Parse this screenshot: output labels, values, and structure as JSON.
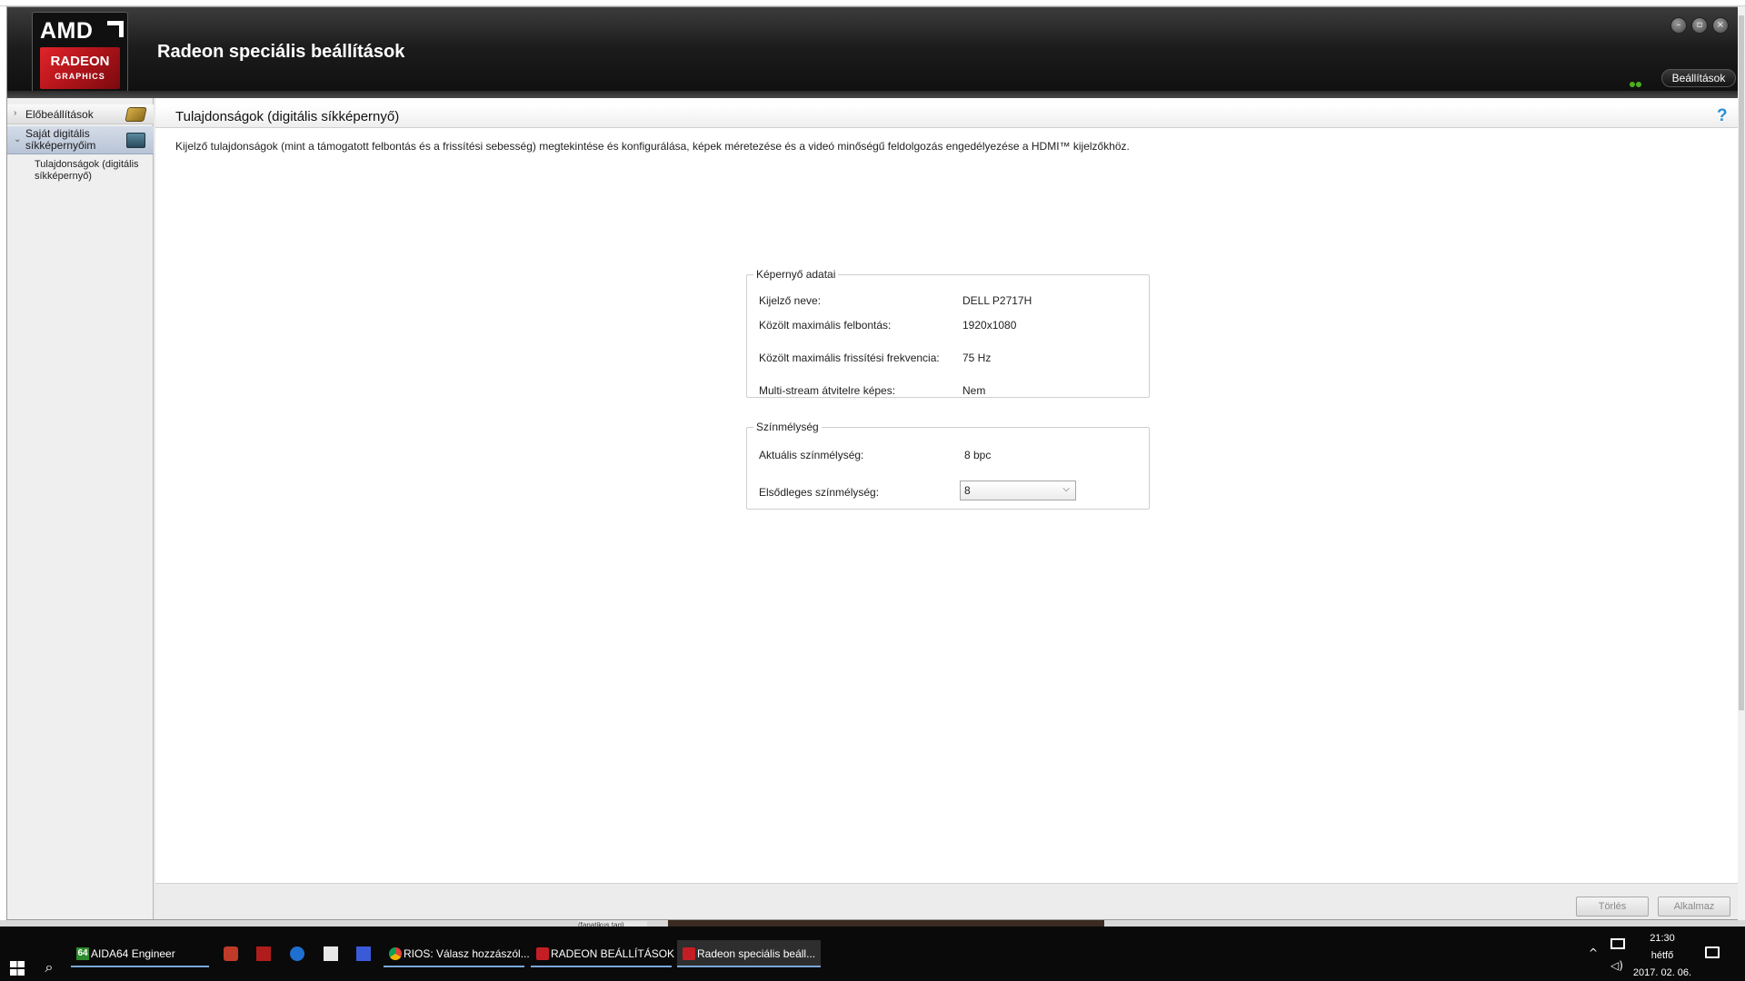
{
  "window": {
    "title": "Radeon speciális beállítások",
    "logo_brand": "AMD",
    "logo_product": "RADEON",
    "logo_sub": "GRAPHICS",
    "settings_label": "Beállítások",
    "minimize_glyph": "–",
    "restore_glyph": "▫",
    "close_glyph": "×"
  },
  "sidebar": {
    "items": [
      {
        "label": "Előbeállítások",
        "expanded": false,
        "icon": "preset-card-icon"
      },
      {
        "label": "Saját digitális síkképernyőim",
        "expanded": true,
        "icon": "monitor-icon"
      },
      {
        "label": "Tulajdonságok (digitális síkképernyő)",
        "child": true
      }
    ],
    "collapsed_chevron": "›",
    "expanded_chevron": "⌄"
  },
  "content": {
    "title": "Tulajdonságok (digitális síkképernyő)",
    "help_glyph": "?",
    "description": "Kijelző tulajdonságok (mint a támogatott felbontás és a frissítési sebesség) megtekintése és konfigurálása, képek méretezése és a videó minőségű feldolgozás engedélyezése a HDMI™ kijelzőkhöz.",
    "display_info": {
      "legend": "Képernyő adatai",
      "rows": [
        {
          "label": "Kijelző neve:",
          "value": "DELL P2717H"
        },
        {
          "label": "Közölt maximális felbontás:",
          "value": "1920x1080"
        },
        {
          "label": "Közölt maximális frissítési frekvencia:",
          "value": "75 Hz"
        },
        {
          "label": "Multi-stream átvitelre képes:",
          "value": "Nem"
        }
      ]
    },
    "color_depth": {
      "legend": "Színmélység",
      "current_label": "Aktuális színmélység:",
      "current_value": "8 bpc",
      "primary_label": "Elsődleges színmélység:",
      "primary_selected": "8",
      "chevron_glyph": "⌵"
    },
    "footer": {
      "discard_label": "Törlés",
      "apply_label": "Alkalmaz"
    }
  },
  "background_fragment": "(fanatikus tag)",
  "taskbar": {
    "apps": [
      {
        "label": "AIDA64 Engineer",
        "icon_text": "64"
      },
      {
        "label": "RIOS: Válasz hozzászól..."
      },
      {
        "label": "RADEON BEÁLLÍTÁSOK"
      },
      {
        "label": "Radeon speciális beáll...",
        "active": true
      }
    ],
    "search_glyph": "⌕",
    "tray_chevron": "^",
    "volume_glyph": "◁)",
    "clock_time": "21:30",
    "clock_day": "hétfő",
    "clock_date": "2017. 02. 06."
  }
}
